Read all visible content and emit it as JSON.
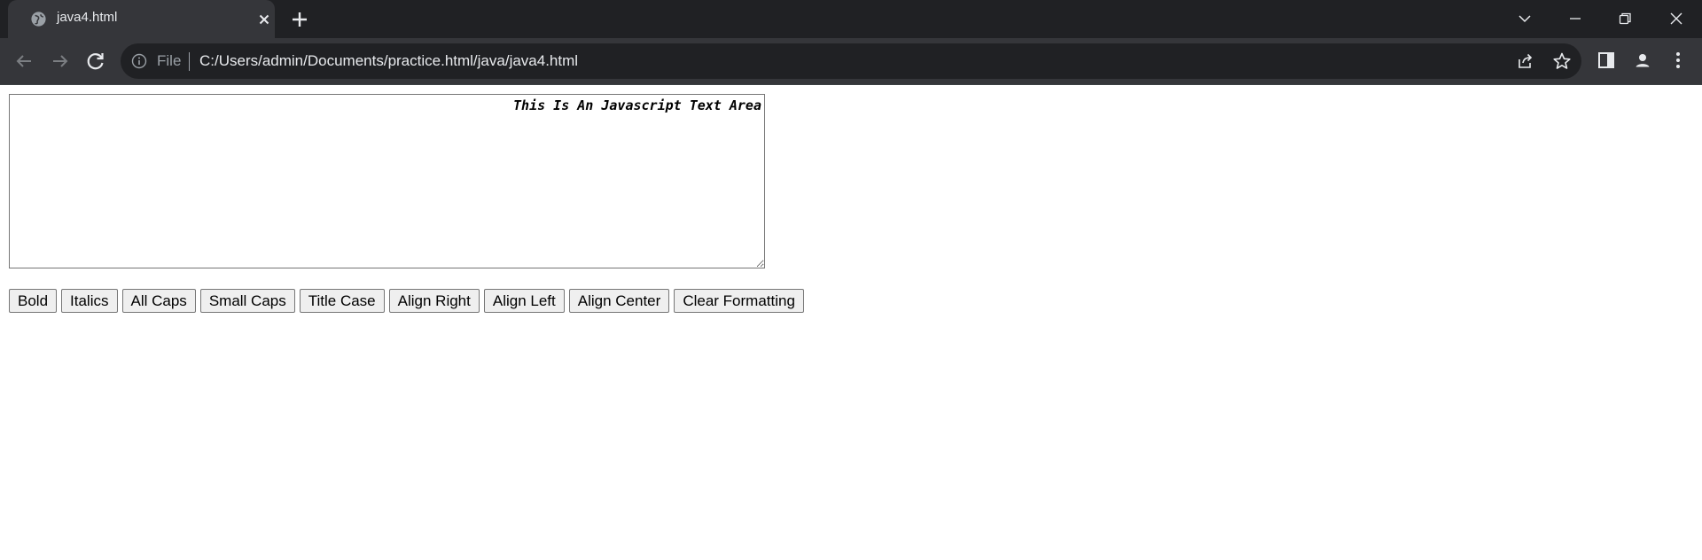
{
  "browser": {
    "tab_title": "java4.html",
    "omnibox": {
      "scheme_label": "File",
      "url": "C:/Users/admin/Documents/practice.html/java/java4.html"
    },
    "icons": {
      "favicon": "globe-icon",
      "tab_close": "close-icon",
      "new_tab": "plus-icon",
      "tab_search": "chevron-down-icon",
      "minimize": "minimize-icon",
      "restore": "restore-icon",
      "close_window": "close-icon",
      "back": "arrow-left-icon",
      "forward": "arrow-right-icon",
      "reload": "reload-icon",
      "site_info": "info-icon",
      "share": "share-icon",
      "bookmark": "star-icon",
      "side_panel": "side-panel-icon",
      "profile": "person-icon",
      "menu": "kebab-menu-icon"
    }
  },
  "page": {
    "textarea_placeholder": "This Is An Javascript Text Area",
    "buttons": {
      "bold": "Bold",
      "italics": "Italics",
      "all_caps": "All Caps",
      "small_caps": "Small Caps",
      "title_case": "Title Case",
      "align_right": "Align Right",
      "align_left": "Align Left",
      "align_center": "Align Center",
      "clear_formatting": "Clear Formatting"
    }
  },
  "colors": {
    "chrome_dark": "#202124",
    "chrome_toolbar": "#35363a",
    "chrome_text": "#e8eaed",
    "chrome_muted": "#9aa0a6",
    "button_bg": "#efefef",
    "border": "#767676"
  }
}
